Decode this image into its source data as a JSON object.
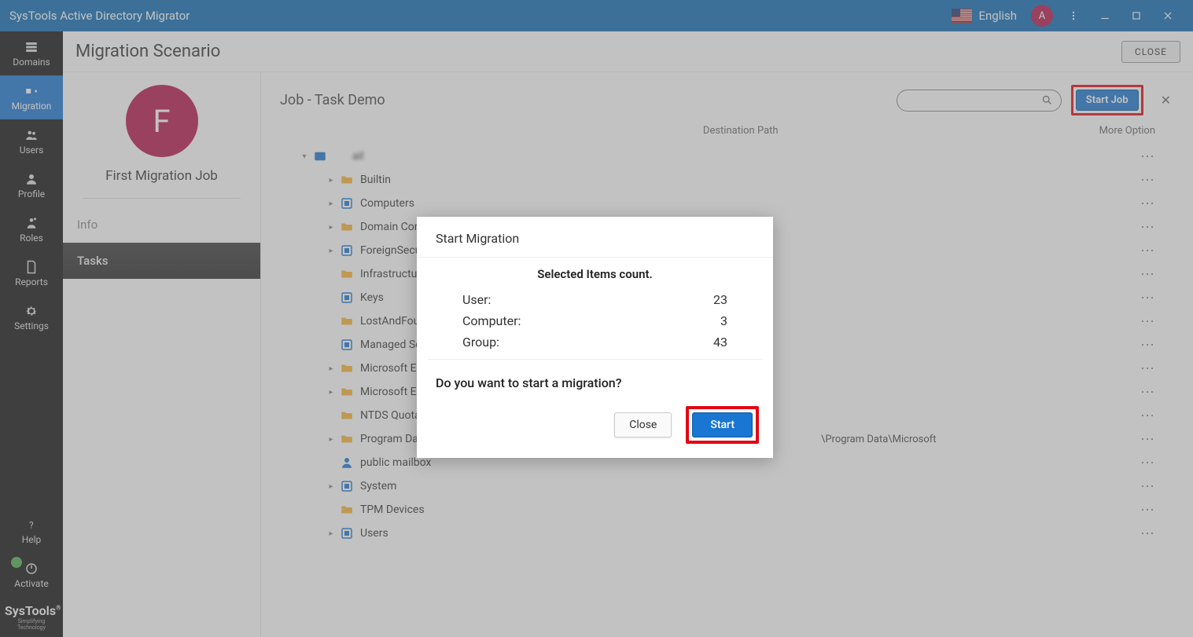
{
  "titlebar": {
    "title": "SysTools Active Directory Migrator",
    "language": "English",
    "avatarLetter": "A"
  },
  "sidebar": {
    "items": [
      {
        "label": "Domains"
      },
      {
        "label": "Migration"
      },
      {
        "label": "Users"
      },
      {
        "label": "Profile"
      },
      {
        "label": "Roles"
      },
      {
        "label": "Reports"
      },
      {
        "label": "Settings"
      }
    ],
    "help": "Help",
    "activate": "Activate",
    "brand": "SysTools",
    "brandSub": "Simplifying Technology"
  },
  "header": {
    "pageTitle": "Migration Scenario",
    "closeLabel": "CLOSE"
  },
  "jobPanel": {
    "avatarLetter": "F",
    "jobName": "First Migration Job",
    "tabs": [
      {
        "label": "Info"
      },
      {
        "label": "Tasks"
      }
    ]
  },
  "detail": {
    "title": "Job - Task Demo",
    "searchPlaceholder": "",
    "startJobLabel": "Start Job",
    "destPathLabel": "Destination Path",
    "moreOptionLabel": "More Option"
  },
  "tree": {
    "root": "ail",
    "nodes": [
      {
        "type": "folder",
        "label": "Builtin",
        "expandable": true
      },
      {
        "type": "ou",
        "label": "Computers",
        "expandable": true
      },
      {
        "type": "folder",
        "label": "Domain Controllers",
        "expandable": true
      },
      {
        "type": "ou",
        "label": "ForeignSecurity",
        "expandable": true
      },
      {
        "type": "folder",
        "label": "Infrastructure",
        "expandable": false
      },
      {
        "type": "ou",
        "label": "Keys",
        "expandable": false
      },
      {
        "type": "folder",
        "label": "LostAndFound",
        "expandable": false
      },
      {
        "type": "ou",
        "label": "Managed Servic",
        "expandable": false
      },
      {
        "type": "folder",
        "label": "Microsoft Excha",
        "expandable": true
      },
      {
        "type": "folder",
        "label": "Microsoft Excha",
        "expandable": true
      },
      {
        "type": "folder",
        "label": "NTDS Quotas",
        "expandable": false
      },
      {
        "type": "folder",
        "label": "Program Data",
        "expandable": true,
        "destPath": "\\Program Data\\Microsoft"
      },
      {
        "type": "user",
        "label": "public mailbox",
        "expandable": false
      },
      {
        "type": "ou",
        "label": "System",
        "expandable": true
      },
      {
        "type": "folder",
        "label": "TPM Devices",
        "expandable": false
      },
      {
        "type": "ou",
        "label": "Users",
        "expandable": true
      }
    ]
  },
  "modal": {
    "title": "Start Migration",
    "subTitle": "Selected Items count.",
    "rows": [
      {
        "label": "User:",
        "value": "23"
      },
      {
        "label": "Computer:",
        "value": "3"
      },
      {
        "label": "Group:",
        "value": "43"
      }
    ],
    "confirm": "Do you want to start a migration?",
    "closeLabel": "Close",
    "startLabel": "Start"
  }
}
